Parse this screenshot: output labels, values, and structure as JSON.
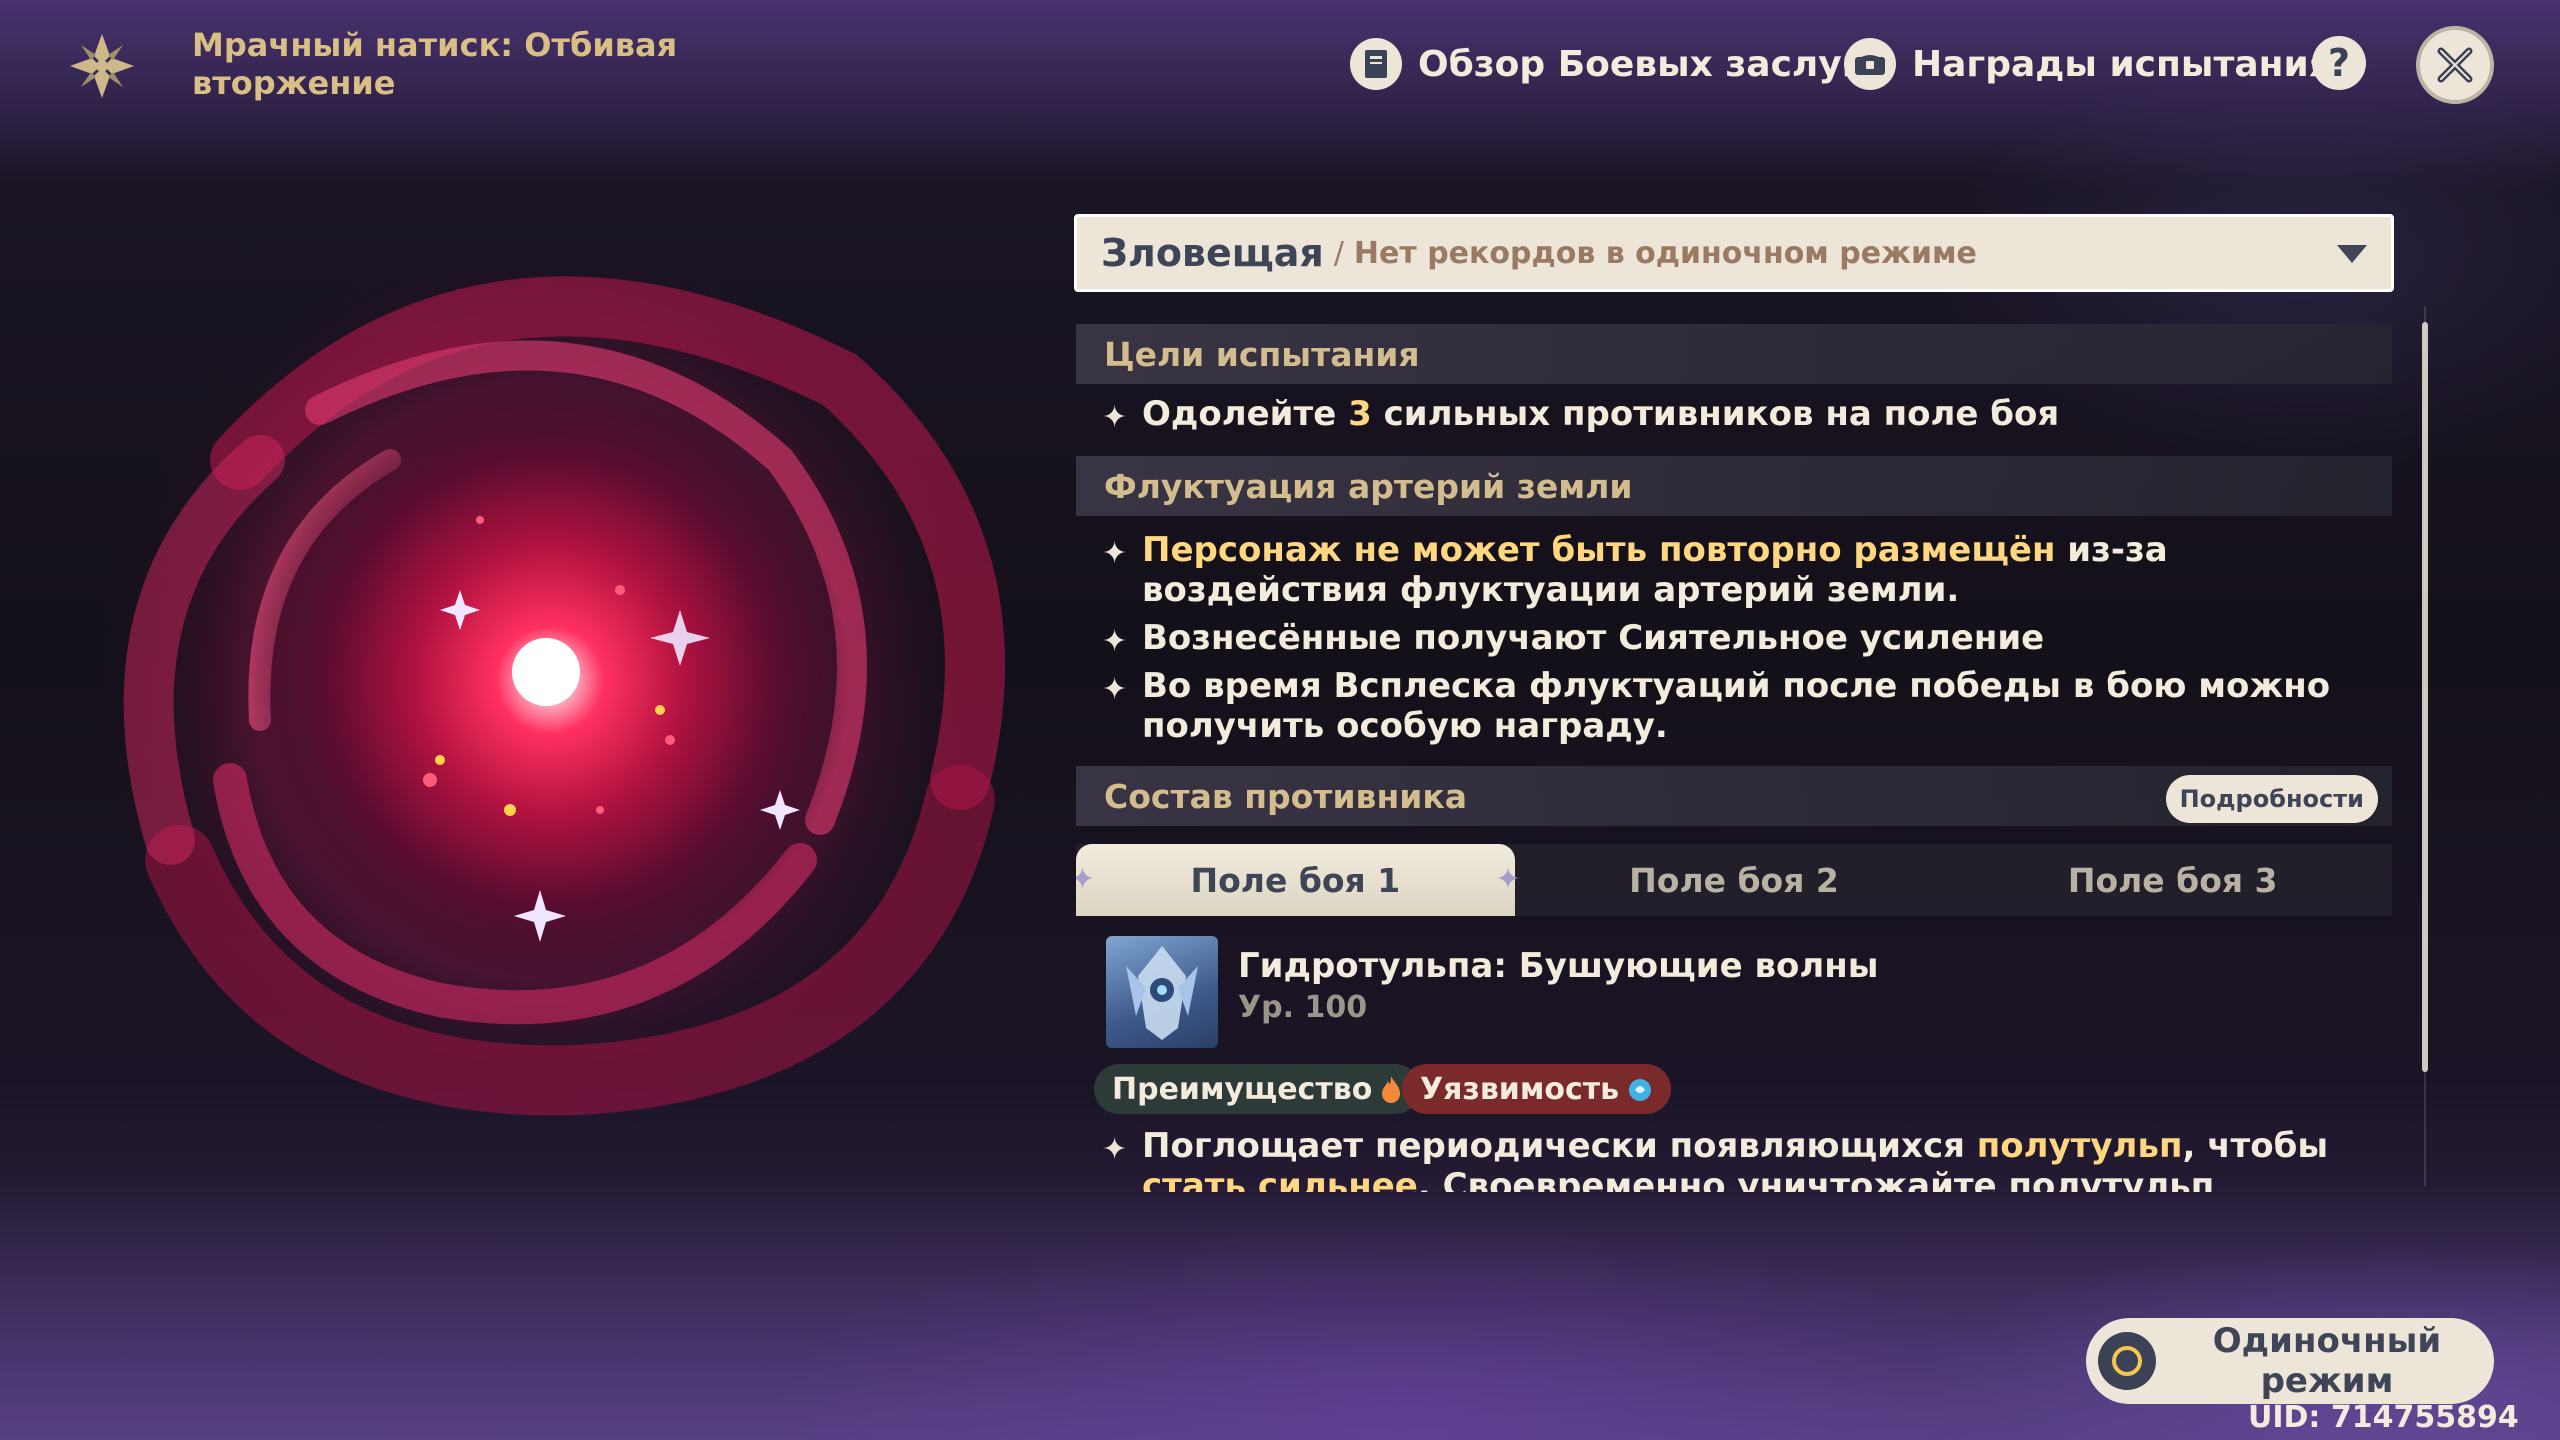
{
  "header": {
    "title": "Мрачный натиск: Отбивая вторжение",
    "battle_overview_label": "Обзор Боевых заслуг",
    "rewards_label": "Награды испытания",
    "help_label": "?"
  },
  "difficulty": {
    "name": "Зловещая",
    "separator": "/",
    "note": "Нет рекордов в одиночном режиме"
  },
  "sections": {
    "goals_title": "Цели испытания",
    "goal_pre": "Одолейте ",
    "goal_count": "3",
    "goal_post": " сильных противников на поле боя",
    "fluct_title": "Флуктуация артерий земли",
    "fluct_1_hl": "Персонаж не может быть повторно размещён",
    "fluct_1_rest": " из-за воздействия флуктуации артерий земли.",
    "fluct_2": "Вознесённые получают Сиятельное усиление",
    "fluct_3": "Во время Всплеска флуктуаций после победы в бою можно получить особую награду.",
    "enemy_title": "Состав противника",
    "details_label": "Подробности"
  },
  "tabs": [
    {
      "label": "Поле боя 1",
      "active": true
    },
    {
      "label": "Поле боя 2",
      "active": false
    },
    {
      "label": "Поле боя 3",
      "active": false
    }
  ],
  "enemy": {
    "name": "Гидротульпа: Бушующие волны",
    "level": "Ур. 100",
    "advantage_label": "Преимущество",
    "weakness_label": "Уязвимость",
    "desc_pre": "Поглощает периодически появляющихся ",
    "desc_hl1": "полутульп",
    "desc_mid": ", чтобы ",
    "desc_hl2": "стать сильнее",
    "desc_post": ". Своевременно уничтожайте полутульп атаками или"
  },
  "mode": {
    "label": "Одиночный\nрежим"
  },
  "uid": "UID: 714755894",
  "colors": {
    "accent_gold": "#ffd780",
    "panel_cream": "#ece5d8",
    "section_title": "#d3bc8e",
    "vortex_red": "#e0205a"
  }
}
